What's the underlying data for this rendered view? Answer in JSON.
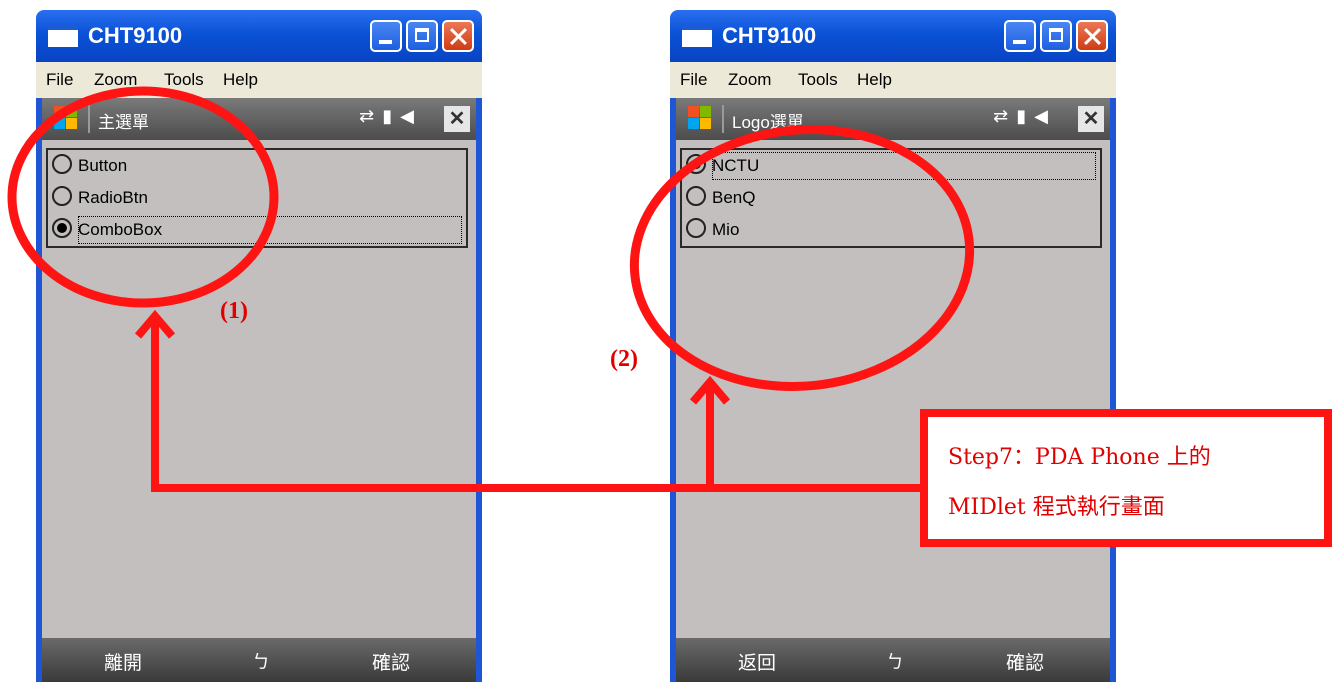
{
  "windows": [
    {
      "title": "CHT9100",
      "menu": [
        "File",
        "Zoom",
        "Tools",
        "Help"
      ],
      "screen_title": "主選單",
      "items": [
        {
          "label": "Button",
          "selected": false
        },
        {
          "label": "RadioBtn",
          "selected": false
        },
        {
          "label": "ComboBox",
          "selected": true
        }
      ],
      "softkeys": {
        "left": "離開",
        "middle": "ㄅ",
        "right": "確認"
      }
    },
    {
      "title": "CHT9100",
      "menu": [
        "File",
        "Zoom",
        "Tools",
        "Help"
      ],
      "screen_title": "Logo選單",
      "items": [
        {
          "label": "NCTU",
          "selected": true
        },
        {
          "label": "BenQ",
          "selected": false
        },
        {
          "label": "Mio",
          "selected": false
        }
      ],
      "softkeys": {
        "left": "返回",
        "middle": "ㄅ",
        "right": "確認"
      }
    }
  ],
  "annotations": {
    "label_1": "(1)",
    "label_2": "(2)",
    "step_line1": "Step7：PDA Phone 上的",
    "step_line2": "MIDlet 程式執行畫面",
    "color": "#ff1414"
  }
}
